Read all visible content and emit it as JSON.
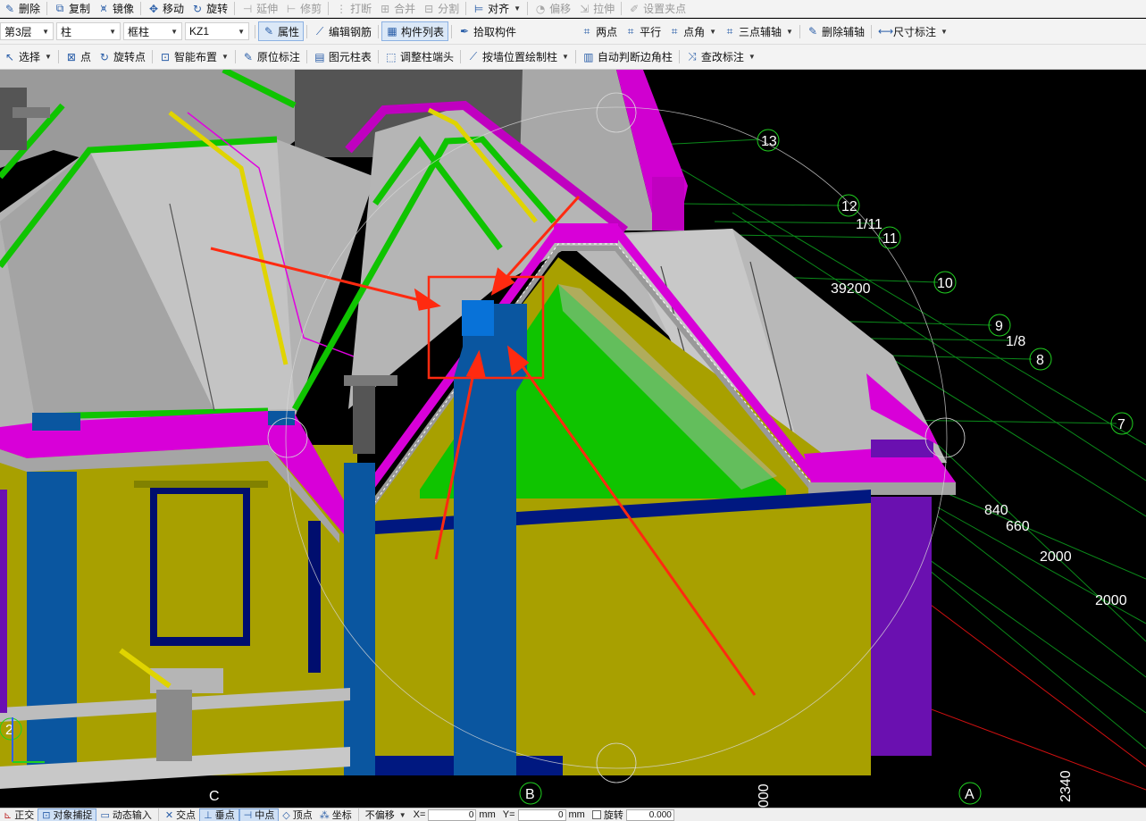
{
  "toolbar1": [
    {
      "label": "删除",
      "icon": "eraser-icon",
      "glyph": "✎",
      "name": "delete-button"
    },
    {
      "label": "复制",
      "icon": "copy-icon",
      "glyph": "⧉",
      "name": "copy-button"
    },
    {
      "label": "镜像",
      "icon": "mirror-icon",
      "glyph": "⩙",
      "name": "mirror-button"
    },
    {
      "label": "移动",
      "icon": "move-icon",
      "glyph": "✥",
      "name": "move-button"
    },
    {
      "label": "旋转",
      "icon": "rotate-icon",
      "glyph": "↻",
      "name": "rotate-button"
    },
    {
      "label": "延伸",
      "icon": "extend-icon",
      "glyph": "⊣",
      "name": "extend-button",
      "disabled": true
    },
    {
      "label": "修剪",
      "icon": "trim-icon",
      "glyph": "⊢",
      "name": "trim-button",
      "disabled": true
    },
    {
      "label": "打断",
      "icon": "break-icon",
      "glyph": "⋮",
      "name": "break-button",
      "disabled": true
    },
    {
      "label": "合并",
      "icon": "merge-icon",
      "glyph": "⊞",
      "name": "merge-button",
      "disabled": true
    },
    {
      "label": "分割",
      "icon": "split-icon",
      "glyph": "⊟",
      "name": "split-button",
      "disabled": true
    },
    {
      "label": "对齐",
      "icon": "align-icon",
      "glyph": "⊨",
      "name": "align-button",
      "dropdown": true
    },
    {
      "label": "偏移",
      "icon": "offset-icon",
      "glyph": "◔",
      "name": "offset-button",
      "disabled": true
    },
    {
      "label": "拉伸",
      "icon": "stretch-icon",
      "glyph": "⇲",
      "name": "stretch-button",
      "disabled": true
    },
    {
      "label": "设置夹点",
      "icon": "grip-icon",
      "glyph": "✐",
      "name": "set-grip-button",
      "disabled": true
    }
  ],
  "selectors": {
    "floor": "第3层",
    "category": "柱",
    "type": "框柱",
    "component": "KZ1"
  },
  "toolbar2": [
    {
      "label": "属性",
      "icon": "properties-icon",
      "glyph": "✎",
      "name": "properties-button",
      "active": true
    },
    {
      "label": "编辑钢筋",
      "icon": "edit-rebar-icon",
      "glyph": "⟋",
      "name": "edit-rebar-button"
    },
    {
      "label": "构件列表",
      "icon": "component-list-icon",
      "glyph": "▦",
      "name": "component-list-button",
      "active": true
    },
    {
      "label": "拾取构件",
      "icon": "pick-icon",
      "glyph": "✒",
      "name": "pick-component-button"
    }
  ],
  "toolbar2b": [
    {
      "label": "两点",
      "icon": "two-point-icon",
      "glyph": "⌗",
      "name": "two-point-button"
    },
    {
      "label": "平行",
      "icon": "parallel-icon",
      "glyph": "⌗",
      "name": "parallel-button"
    },
    {
      "label": "点角",
      "icon": "point-angle-icon",
      "glyph": "⌗",
      "name": "point-angle-button",
      "dropdown": true
    },
    {
      "label": "三点辅轴",
      "icon": "three-point-icon",
      "glyph": "⌗",
      "name": "three-point-axis-button",
      "dropdown": true
    },
    {
      "label": "删除辅轴",
      "icon": "delete-axis-icon",
      "glyph": "✎",
      "name": "delete-axis-button"
    },
    {
      "label": "尺寸标注",
      "icon": "dimension-icon",
      "glyph": "⟷",
      "name": "dimension-button",
      "dropdown": true
    }
  ],
  "toolbar3": [
    {
      "label": "选择",
      "icon": "cursor-icon",
      "glyph": "↖",
      "name": "select-button",
      "dropdown": true
    },
    {
      "label": "点",
      "icon": "point-icon",
      "glyph": "⊠",
      "name": "point-button"
    },
    {
      "label": "旋转点",
      "icon": "rotate-point-icon",
      "glyph": "↻",
      "name": "rotate-point-button"
    },
    {
      "label": "智能布置",
      "icon": "smart-layout-icon",
      "glyph": "⊡",
      "name": "smart-layout-button",
      "dropdown": true
    },
    {
      "label": "原位标注",
      "icon": "in-situ-icon",
      "glyph": "✎",
      "name": "in-situ-label-button"
    },
    {
      "label": "图元柱表",
      "icon": "column-table-icon",
      "glyph": "▤",
      "name": "column-table-button"
    },
    {
      "label": "调整柱端头",
      "icon": "adjust-column-icon",
      "glyph": "⬚",
      "name": "adjust-column-end-button"
    },
    {
      "label": "按墙位置绘制柱",
      "icon": "wall-column-icon",
      "glyph": "⟋",
      "name": "draw-column-by-wall-button",
      "dropdown": true
    },
    {
      "label": "自动判断边角柱",
      "icon": "auto-corner-icon",
      "glyph": "▥",
      "name": "auto-corner-column-button"
    },
    {
      "label": "查改标注",
      "icon": "check-label-icon",
      "glyph": "⤨",
      "name": "check-label-button",
      "dropdown": true
    }
  ],
  "axis_labels": {
    "a13": "13",
    "a12": "12",
    "a1_11": "1/11",
    "a11": "11",
    "a10": "10",
    "a9": "9",
    "a1_8": "1/8",
    "a8": "8",
    "a7": "7",
    "a2": "2",
    "aB": "B",
    "aA": "A",
    "aC": "C"
  },
  "dimensions": {
    "d39200": "39200",
    "d840": "840",
    "d660": "660",
    "d2000a": "2000",
    "d2000b": "2000",
    "d2340": "2340",
    "d000": "000"
  },
  "statusbar": {
    "orthogonal": "正交",
    "object_snap": "对象捕捉",
    "dynamic_input": "动态输入",
    "intersection": "交点",
    "perpendicular": "垂点",
    "midpoint": "中点",
    "vertex": "顶点",
    "coordinate": "坐标",
    "offset_mode": "不偏移",
    "x_label": "X=",
    "x_value": "0",
    "y_label": "Y=",
    "y_value": "0",
    "unit": "mm",
    "rotate_label": "旋转",
    "rotate_value": "0.000"
  },
  "colors": {
    "wall_yellow": "#a8a000",
    "column_blue": "#0a56a0",
    "beam_green": "#0fc400",
    "edge_magenta": "#d800d8",
    "roof_gray": "#b8b8b8",
    "annotation_red": "#ff2a10",
    "accent_purple": "#6a10b0"
  }
}
